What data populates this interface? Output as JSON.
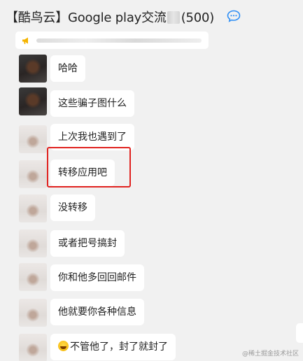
{
  "header": {
    "title_prefix": "【酷鸟云】Google play交流",
    "title_suffix": "(500)"
  },
  "messages": [
    {
      "text": "哈哈",
      "avatar": "dark"
    },
    {
      "text": "这些骗子图什么",
      "avatar": "dark"
    },
    {
      "text": "上次我也遇到了",
      "avatar": "light"
    },
    {
      "text": "转移应用吧",
      "avatar": "light",
      "highlighted": true
    },
    {
      "text": "没转移",
      "avatar": "light"
    },
    {
      "text": "或者把号搞封",
      "avatar": "light"
    },
    {
      "text": "你和他多回回邮件",
      "avatar": "light"
    },
    {
      "text": "他就要你各种信息",
      "avatar": "light"
    },
    {
      "text": "不管他了，封了就封了",
      "avatar": "light",
      "emoji": "grinning-sweat"
    }
  ],
  "watermark": "@稀土掘金技术社区",
  "colors": {
    "background": "#f1f1f1",
    "bubble": "#ffffff",
    "highlight": "#e0221f",
    "chat_icon": "#2f8ff5"
  }
}
